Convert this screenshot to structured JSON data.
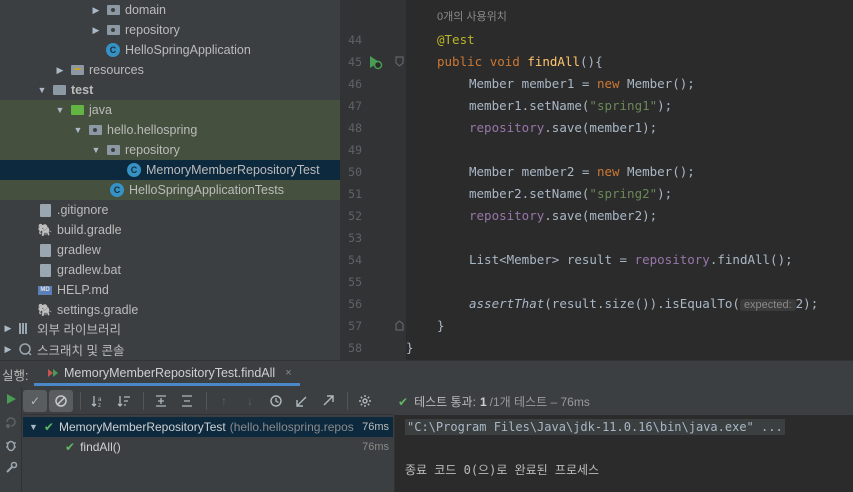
{
  "tree": {
    "items": [
      {
        "label": "domain"
      },
      {
        "label": "repository"
      },
      {
        "label": "HelloSpringApplication"
      },
      {
        "label": "resources"
      },
      {
        "label": "test"
      },
      {
        "label": "java"
      },
      {
        "label": "hello.hellospring"
      },
      {
        "label": "repository"
      },
      {
        "label": "MemoryMemberRepositoryTest"
      },
      {
        "label": "HelloSpringApplicationTests"
      },
      {
        "label": ".gitignore"
      },
      {
        "label": "build.gradle"
      },
      {
        "label": "gradlew"
      },
      {
        "label": "gradlew.bat"
      },
      {
        "label": "HELP.md"
      },
      {
        "label": "settings.gradle"
      },
      {
        "label": "외부 라이브러리"
      },
      {
        "label": "스크래치 및 콘솔"
      }
    ]
  },
  "editor": {
    "usage_hint": "0개의 사용위치",
    "line_numbers": [
      "44",
      "45",
      "46",
      "47",
      "48",
      "49",
      "50",
      "51",
      "52",
      "53",
      "54",
      "55",
      "56",
      "57",
      "58"
    ],
    "annotation": "@Test",
    "kw_public": "public",
    "kw_void": "void",
    "method_name": "findAll",
    "sig_rest": "(){",
    "l46_a": "Member member1 = ",
    "kw_new": "new",
    "l46_b": " Member();",
    "l47_a": "member1.setName(",
    "l47_str": "\"spring1\"",
    "l47_b": ");",
    "repo": "repository",
    "l48_b": ".save(member1);",
    "l50_a": "Member member2 = ",
    "l50_b": " Member();",
    "l51_a": "member2.setName(",
    "l51_str": "\"spring2\"",
    "l51_b": ");",
    "l52_b": ".save(member2);",
    "l54_a": "List<Member> result = ",
    "l54_b": ".findAll();",
    "assert_fn": "assertThat",
    "l56_a": "(result.size()).isEqualTo(",
    "param_hint": "expected:",
    "l56_b": "2);",
    "close_brace": "}",
    "close_class": "}"
  },
  "run": {
    "label": "실행:",
    "tab_label": "MemoryMemberRepositoryTest.findAll",
    "close_icon": "×",
    "status_pass": "테스트 통과:",
    "status_count": "1",
    "status_rest": "/1개 테스트 – 76ms",
    "results": [
      {
        "name": "MemoryMemberRepositoryTest",
        "pkg": "(hello.hellospring.repos",
        "time": "76ms"
      },
      {
        "name": "findAll()",
        "pkg": "",
        "time": "76ms"
      }
    ],
    "console_line1": "\"C:\\Program Files\\Java\\jdk-11.0.16\\bin\\java.exe\" ...",
    "console_line2": "종료 코드 0(으)로 완료된 프로세스"
  },
  "colors": {
    "accent": "#4a88c7",
    "pass": "#5fb85f",
    "run_green": "#499c54"
  }
}
